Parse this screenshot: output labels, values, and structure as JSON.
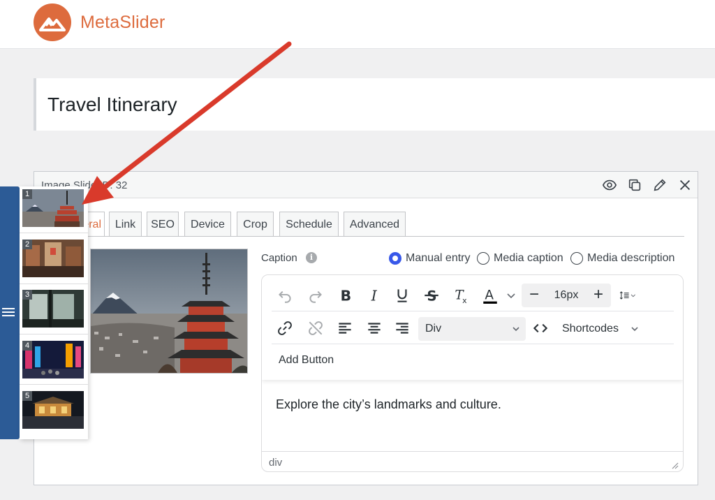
{
  "brand": {
    "name": "MetaSlider",
    "color": "#dd6b3d"
  },
  "page_title": "Travel Itinerary",
  "slide": {
    "id_label": "Image Slide ID: 32",
    "header_icons": [
      "eye-icon",
      "duplicate-icon",
      "pencil-icon",
      "close-icon"
    ]
  },
  "tabs": [
    {
      "label": "General",
      "active": true
    },
    {
      "label": "Link"
    },
    {
      "label": "SEO"
    },
    {
      "label": "Device"
    },
    {
      "label": "Crop"
    },
    {
      "label": "Schedule"
    },
    {
      "label": "Advanced"
    }
  ],
  "caption": {
    "label": "Caption",
    "options": [
      {
        "label": "Manual entry",
        "selected": true
      },
      {
        "label": "Media caption"
      },
      {
        "label": "Media description"
      }
    ]
  },
  "editor": {
    "font_size": "16px",
    "block_format": "Div",
    "shortcodes_label": "Shortcodes",
    "add_button_label": "Add Button",
    "content": "Explore the city’s landmarks and culture.",
    "status_path": "div"
  },
  "thumbnails": [
    {
      "number": "1"
    },
    {
      "number": "2"
    },
    {
      "number": "3"
    },
    {
      "number": "4"
    },
    {
      "number": "5"
    }
  ],
  "colors": {
    "accent": "#dd6b3d",
    "radio": "#3858e9",
    "sidebar": "#2c5b96",
    "arrow": "#d93a2b"
  }
}
